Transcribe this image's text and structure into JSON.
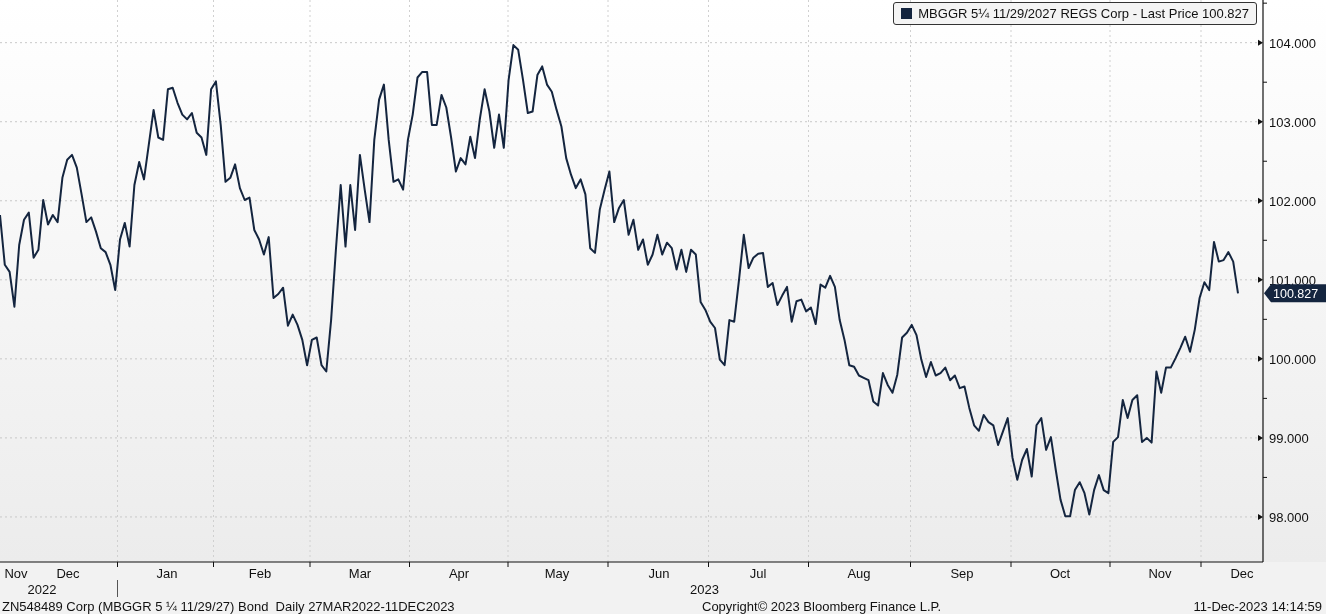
{
  "legend": {
    "value": "100.827"
  },
  "chart": {
    "last_price_tag": "100.827",
    "years": [
      {
        "label": "2022",
        "months": [
          "Nov",
          "Dec"
        ]
      },
      {
        "label": "2023",
        "months": [
          "Jan",
          "Feb",
          "Mar",
          "Apr",
          "May",
          "Jun",
          "Jul",
          "Aug",
          "Sep",
          "Oct",
          "Nov",
          "Dec"
        ]
      }
    ],
    "chart_data": {
      "type": "line",
      "grid": true,
      "ylim": [
        97.43,
        104.54
      ],
      "yticks": [
        {
          "value": 98,
          "label": "98.000"
        },
        {
          "value": 99,
          "label": "99.000"
        },
        {
          "value": 100,
          "label": "100.000"
        },
        {
          "value": 101,
          "label": "101.000"
        },
        {
          "value": 102,
          "label": "102.000"
        },
        {
          "value": 103,
          "label": "103.000"
        },
        {
          "value": 104,
          "label": "104.000"
        }
      ],
      "series": [
        {
          "name": "MBGGR 5¼ 11/29/2027 REGS Corp - Last Price",
          "color": "#14253f",
          "values": [
            101.82,
            101.19,
            101.1,
            100.66,
            101.44,
            101.76,
            101.85,
            101.28,
            101.38,
            102.01,
            101.7,
            101.82,
            101.73,
            102.29,
            102.52,
            102.58,
            102.42,
            102.08,
            101.73,
            101.79,
            101.61,
            101.4,
            101.35,
            101.19,
            100.87,
            101.51,
            101.72,
            101.42,
            102.2,
            102.49,
            102.27,
            102.71,
            103.15,
            102.8,
            102.77,
            103.41,
            103.43,
            103.24,
            103.09,
            103.03,
            103.11,
            102.86,
            102.8,
            102.58,
            103.41,
            103.51,
            102.96,
            102.24,
            102.29,
            102.46,
            102.16,
            102.01,
            102.04,
            101.63,
            101.51,
            101.32,
            101.54,
            100.77,
            100.82,
            100.9,
            100.42,
            100.56,
            100.43,
            100.24,
            99.92,
            100.24,
            100.27,
            99.92,
            99.84,
            100.49,
            101.38,
            102.2,
            101.42,
            102.2,
            101.63,
            102.58,
            102.14,
            101.73,
            102.77,
            103.28,
            103.47,
            102.77,
            102.24,
            102.27,
            102.14,
            102.77,
            103.09,
            103.56,
            103.63,
            103.63,
            102.96,
            102.96,
            103.34,
            103.18,
            102.8,
            102.37,
            102.54,
            102.46,
            102.81,
            102.54,
            103.03,
            103.41,
            103.13,
            102.67,
            103.09,
            102.67,
            103.53,
            103.97,
            103.91,
            103.53,
            103.11,
            103.13,
            103.59,
            103.7,
            103.47,
            103.38,
            103.15,
            102.94,
            102.54,
            102.33,
            102.16,
            102.27,
            102.08,
            101.4,
            101.34,
            101.89,
            102.14,
            102.37,
            101.73,
            101.91,
            102.01,
            101.57,
            101.76,
            101.38,
            101.51,
            101.19,
            101.32,
            101.57,
            101.32,
            101.47,
            101.4,
            101.13,
            101.38,
            101.1,
            101.38,
            101.32,
            100.72,
            100.62,
            100.47,
            100.39,
            99.99,
            99.92,
            100.49,
            100.47,
            101.0,
            101.57,
            101.15,
            101.28,
            101.33,
            101.34,
            100.91,
            100.96,
            100.68,
            100.8,
            100.91,
            100.47,
            100.73,
            100.75,
            100.6,
            100.65,
            100.44,
            100.94,
            100.9,
            101.05,
            100.91,
            100.49,
            100.24,
            99.92,
            99.9,
            99.79,
            99.76,
            99.73,
            99.46,
            99.41,
            99.82,
            99.67,
            99.57,
            99.8,
            100.27,
            100.33,
            100.43,
            100.3,
            99.99,
            99.77,
            99.96,
            99.79,
            99.82,
            99.89,
            99.73,
            99.79,
            99.63,
            99.65,
            99.38,
            99.16,
            99.09,
            99.29,
            99.2,
            99.16,
            98.91,
            99.08,
            99.25,
            98.75,
            98.47,
            98.72,
            98.86,
            98.51,
            99.16,
            99.25,
            98.85,
            99.01,
            98.6,
            98.22,
            98.01,
            98.01,
            98.34,
            98.44,
            98.3,
            98.03,
            98.34,
            98.53,
            98.34,
            98.3,
            98.95,
            99.01,
            99.48,
            99.25,
            99.48,
            99.54,
            98.95,
            99.0,
            98.94,
            99.84,
            99.57,
            99.89,
            99.89,
            100.01,
            100.14,
            100.28,
            100.09,
            100.37,
            100.77,
            100.97,
            100.87,
            101.48,
            101.23,
            101.25,
            101.35,
            101.23,
            100.83
          ]
        }
      ]
    }
  },
  "footer": {
    "security": "ZN548489 Corp (MBGGR 5 ¼ 11/29/27) Bond  Daily 27MAR2022-11DEC2023",
    "copyright": "Copyright© 2023 Bloomberg Finance L.P.",
    "timestamp": "11-Dec-2023 14:14:59"
  }
}
